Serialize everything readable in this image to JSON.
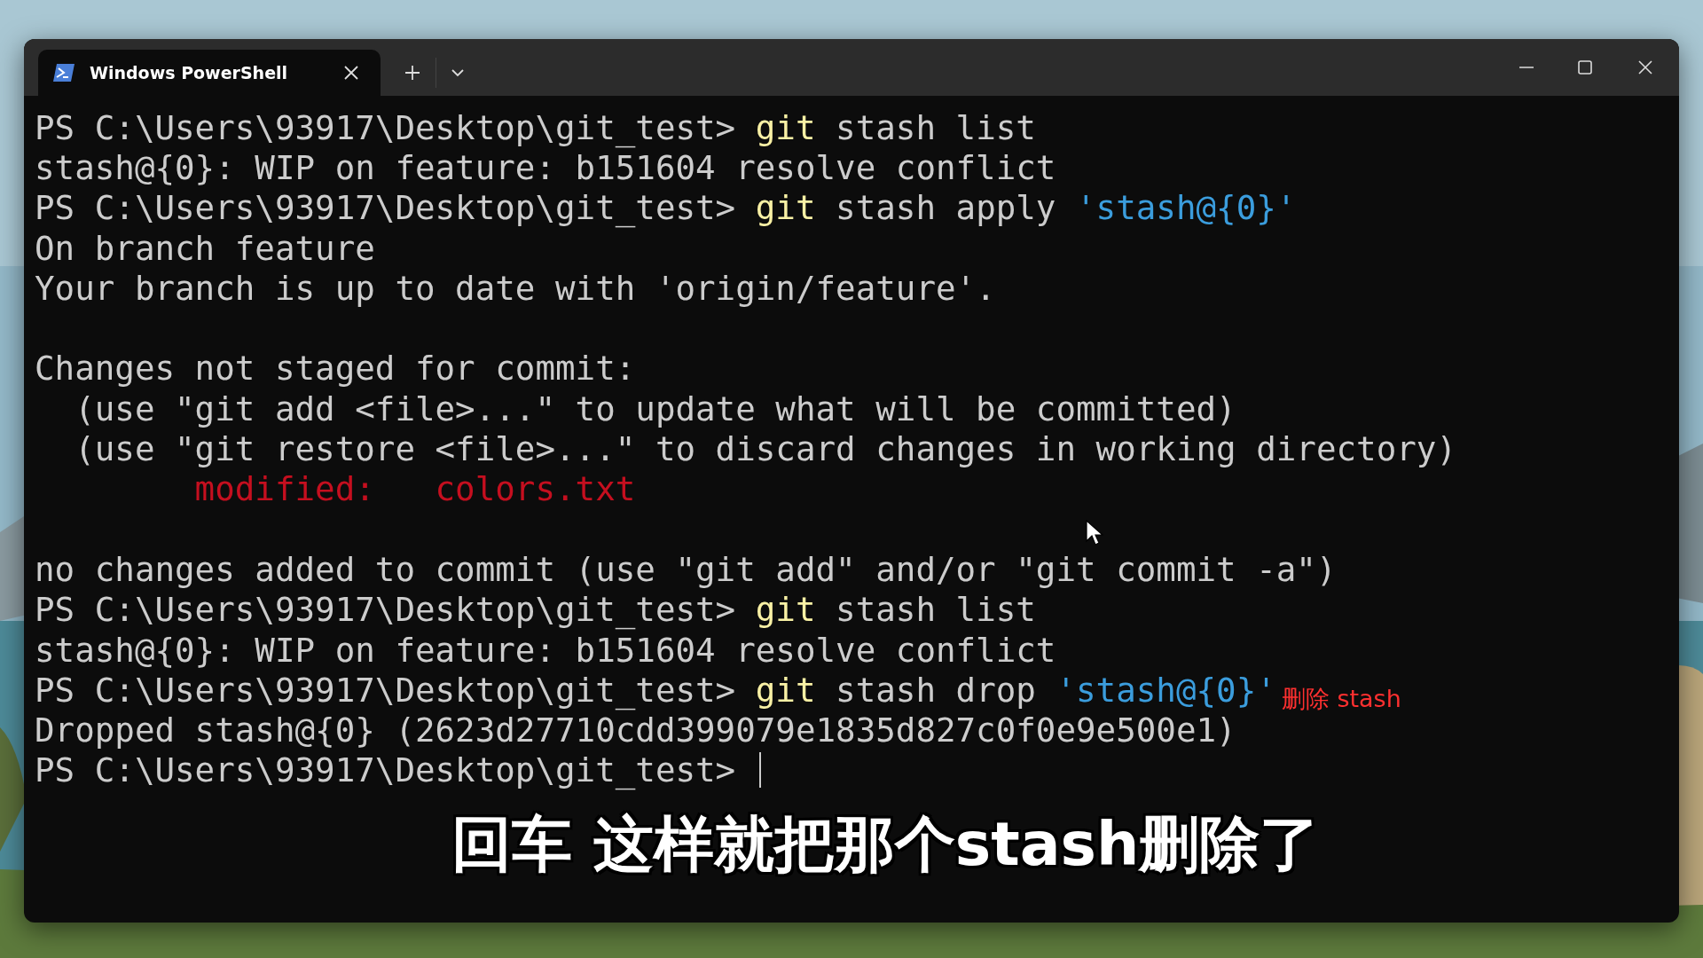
{
  "window": {
    "tabs": [
      {
        "title": "Windows PowerShell",
        "selected": true
      }
    ]
  },
  "terminal": {
    "lines": [
      {
        "kind": "text",
        "segments": [
          {
            "kind": "plain",
            "text": "PS C:\\Users\\93917\\Desktop\\git_test> "
          },
          {
            "kind": "cmd",
            "text": "git"
          },
          {
            "kind": "plain",
            "text": " stash list"
          }
        ]
      },
      {
        "kind": "text",
        "segments": [
          {
            "kind": "plain",
            "text": "stash@{0}: WIP on feature: b151604 resolve conflict"
          }
        ]
      },
      {
        "kind": "text",
        "segments": [
          {
            "kind": "plain",
            "text": "PS C:\\Users\\93917\\Desktop\\git_test> "
          },
          {
            "kind": "cmd",
            "text": "git"
          },
          {
            "kind": "plain",
            "text": " stash apply "
          },
          {
            "kind": "str",
            "text": "'stash@{0}'"
          }
        ]
      },
      {
        "kind": "text",
        "segments": [
          {
            "kind": "plain",
            "text": "On branch feature"
          }
        ]
      },
      {
        "kind": "text",
        "segments": [
          {
            "kind": "plain",
            "text": "Your branch is up to date with 'origin/feature'."
          }
        ]
      },
      {
        "kind": "blank"
      },
      {
        "kind": "text",
        "segments": [
          {
            "kind": "plain",
            "text": "Changes not staged for commit:"
          }
        ]
      },
      {
        "kind": "text",
        "segments": [
          {
            "kind": "plain",
            "text": "  (use \"git add <file>...\" to update what will be committed)"
          }
        ]
      },
      {
        "kind": "text",
        "segments": [
          {
            "kind": "plain",
            "text": "  (use \"git restore <file>...\" to discard changes in working directory)"
          }
        ]
      },
      {
        "kind": "text",
        "segments": [
          {
            "kind": "mod",
            "text": "        modified:   colors.txt"
          }
        ]
      },
      {
        "kind": "blank"
      },
      {
        "kind": "text",
        "segments": [
          {
            "kind": "plain",
            "text": "no changes added to commit (use \"git add\" and/or \"git commit -a\")"
          }
        ]
      },
      {
        "kind": "text",
        "segments": [
          {
            "kind": "plain",
            "text": "PS C:\\Users\\93917\\Desktop\\git_test> "
          },
          {
            "kind": "cmd",
            "text": "git"
          },
          {
            "kind": "plain",
            "text": " stash list"
          }
        ]
      },
      {
        "kind": "text",
        "segments": [
          {
            "kind": "plain",
            "text": "stash@{0}: WIP on feature: b151604 resolve conflict"
          }
        ]
      },
      {
        "kind": "text",
        "segments": [
          {
            "kind": "plain",
            "text": "PS C:\\Users\\93917\\Desktop\\git_test> "
          },
          {
            "kind": "cmd",
            "text": "git"
          },
          {
            "kind": "plain",
            "text": " stash drop "
          },
          {
            "kind": "str",
            "text": "'stash@{0}'"
          },
          {
            "kind": "note",
            "text": "删除 stash"
          }
        ]
      },
      {
        "kind": "text",
        "segments": [
          {
            "kind": "plain",
            "text": "Dropped stash@{0} (2623d27710cdd399079e1835d827c0f0e9e500e1)"
          }
        ]
      },
      {
        "kind": "prompt",
        "segments": [
          {
            "kind": "plain",
            "text": "PS C:\\Users\\93917\\Desktop\\git_test> "
          }
        ]
      }
    ]
  },
  "subtitle": "回车 这样就把那个stash删除了"
}
